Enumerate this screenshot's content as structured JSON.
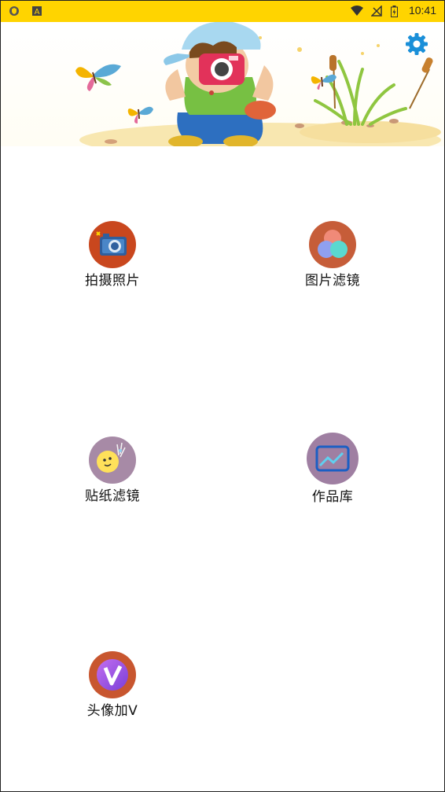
{
  "status_bar": {
    "time": "10:41",
    "left_icons": [
      "shield-icon",
      "font-icon"
    ],
    "right_icons": [
      "wifi-icon",
      "no-signal-icon",
      "battery-icon"
    ],
    "background": "#ffd400"
  },
  "banner": {
    "image": "boy-with-camera-illustration",
    "settings_icon": "gear-icon",
    "accent": "#1a8fd8"
  },
  "menu": {
    "items": [
      {
        "label": "拍摄照片",
        "icon": "camera-icon",
        "icon_bg": "#c9471e"
      },
      {
        "label": "图片滤镜",
        "icon": "color-circles-icon",
        "icon_bg": "#c65d39"
      },
      {
        "label": "贴纸滤镜",
        "icon": "sticker-face-icon",
        "icon_bg": "#a78aa6"
      },
      {
        "label": "作品库",
        "icon": "gallery-icon",
        "icon_bg": "#9f7fa2"
      },
      {
        "label": "头像加V",
        "icon": "v-badge-icon",
        "icon_bg": "#c8562f"
      }
    ]
  }
}
